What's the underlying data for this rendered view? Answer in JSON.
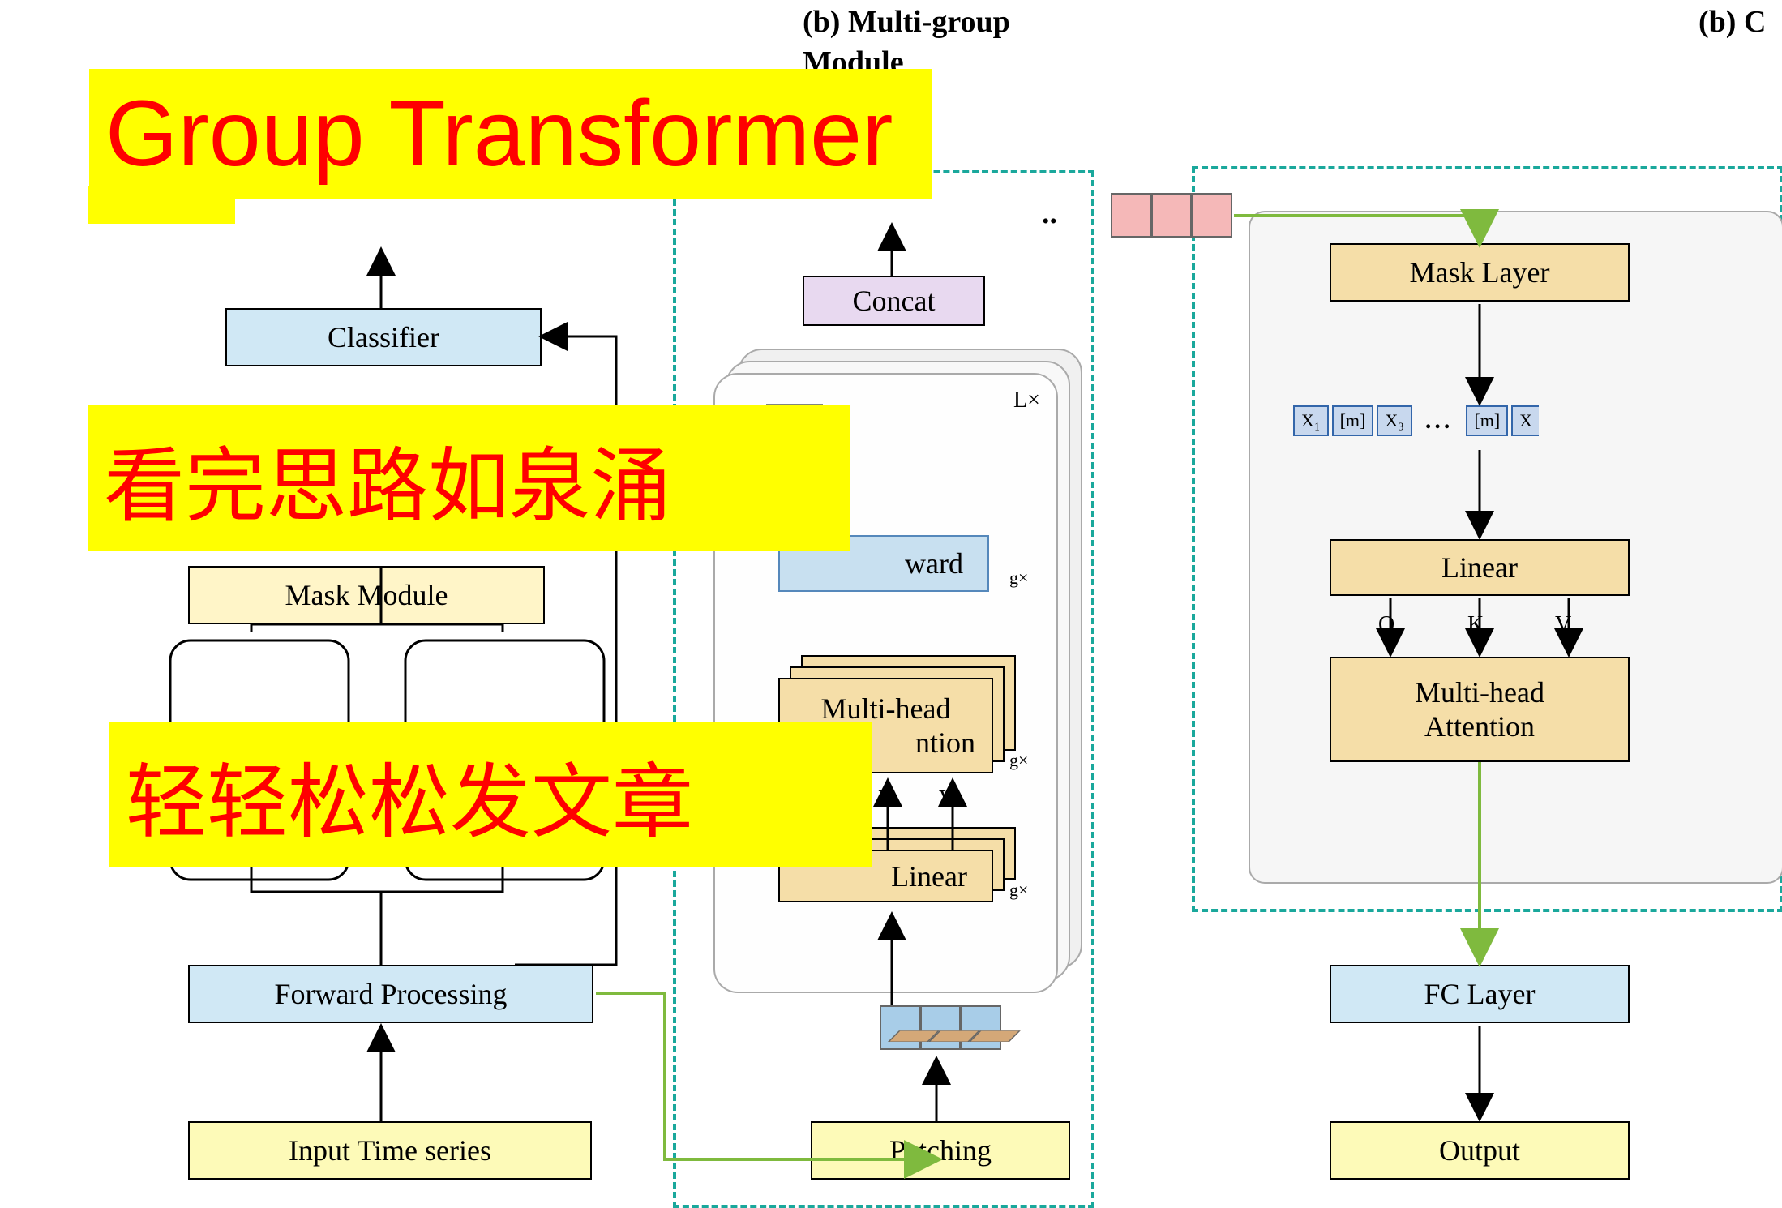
{
  "headers": {
    "b_multigroup": "(b) Multi-group",
    "b_module": "Module",
    "b_right": "(b) C"
  },
  "overlays": {
    "title": "Group Transformer",
    "line1": "看完思路如泉涌",
    "line2": "轻轻松松发文章"
  },
  "left": {
    "classifier": "Classifier",
    "mask_module": "Mask Module",
    "forward_processing": "Forward Processing",
    "input_time_series": "Input Time series"
  },
  "center": {
    "concat": "Concat",
    "ward": "ward",
    "multi_head": "Multi-head",
    "ntion": "ntion",
    "linear": "Linear",
    "patching": "Patching",
    "Lx": "L×",
    "gx": "g×",
    "qkv_v": "V",
    "qkv_k": "K"
  },
  "right": {
    "mask_layer": "Mask Layer",
    "tokens": [
      "X₁",
      "[m]",
      "X₃"
    ],
    "tokens_right": [
      "[m]",
      "X"
    ],
    "ellipsis": "...",
    "linear": "Linear",
    "q": "Q",
    "k": "K",
    "v": "V",
    "multi_head": "Multi-head",
    "attention": "Attention",
    "fc_layer": "FC Layer",
    "output": "Output"
  }
}
